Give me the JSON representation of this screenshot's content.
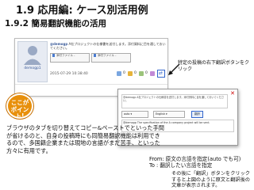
{
  "header": {
    "title": "1.9  応用編: ケース別活用例",
    "subtitle": "1.9.2  簡易翻訳機能の活用"
  },
  "post": {
    "user": "@demogp",
    "text": "A社プロジェクトの仕様書を送付します。添付資料に目を通しておいてください。",
    "avatar_label": "demogp1",
    "attachments": [
      "添付ファイル -",
      "添付ファイル -"
    ],
    "date": "2015-07-29 10:38:40",
    "toolbar_counts": [
      "0",
      "0",
      "0"
    ],
    "icons": [
      "like-icon",
      "star-icon",
      "reply-icon",
      "translate-icon"
    ]
  },
  "notes": {
    "translate_button_tip": "特定の投稿の右下翻訳ボタンをクリック",
    "badge": "ここが\nポイント!",
    "body": "ブラウザのタブを切り替えてコピー&ペーストでといった手間が省けるのと、自身の投稿時にも同簡易翻訳機能は利用できるので、多国籍企業または現地の言語がまだ苦手、といった方々に有用です。",
    "from_to": "From: 原文の言語を指定(auto でも可)\nTo : 翻訳したい言語を指定",
    "after": "その後に「翻訳」ボタンをクリックすると上図のように原文と翻訳後の文章が表示されます。"
  },
  "popup": {
    "source_text": "@demogp A社プロジェクトの仕様書を送付します。添付資料に目を通しておいてください。",
    "from_value": "auto",
    "to_value": "English",
    "translate_label": "翻訳",
    "result_text": "@demogp The specification of the A company project will be sent."
  },
  "colors": {
    "badge": "#e8900c",
    "accent": "#3366cc"
  }
}
